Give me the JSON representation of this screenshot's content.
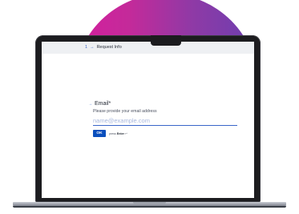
{
  "header": {
    "step_number": "1",
    "step_arrow": "→",
    "title": "Request Info"
  },
  "question": {
    "number": "1",
    "arrow": "→",
    "label": "Email*",
    "description": "Please provide your email address",
    "input_value": "",
    "input_placeholder": "name@example.com"
  },
  "actions": {
    "ok_label": "OK",
    "hint_prefix": "press",
    "hint_key": "Enter",
    "hint_symbol": "↵"
  },
  "colors": {
    "accent": "#0b4fbd",
    "blob_start": "#d41f9e",
    "blob_end": "#6b3fb0"
  }
}
